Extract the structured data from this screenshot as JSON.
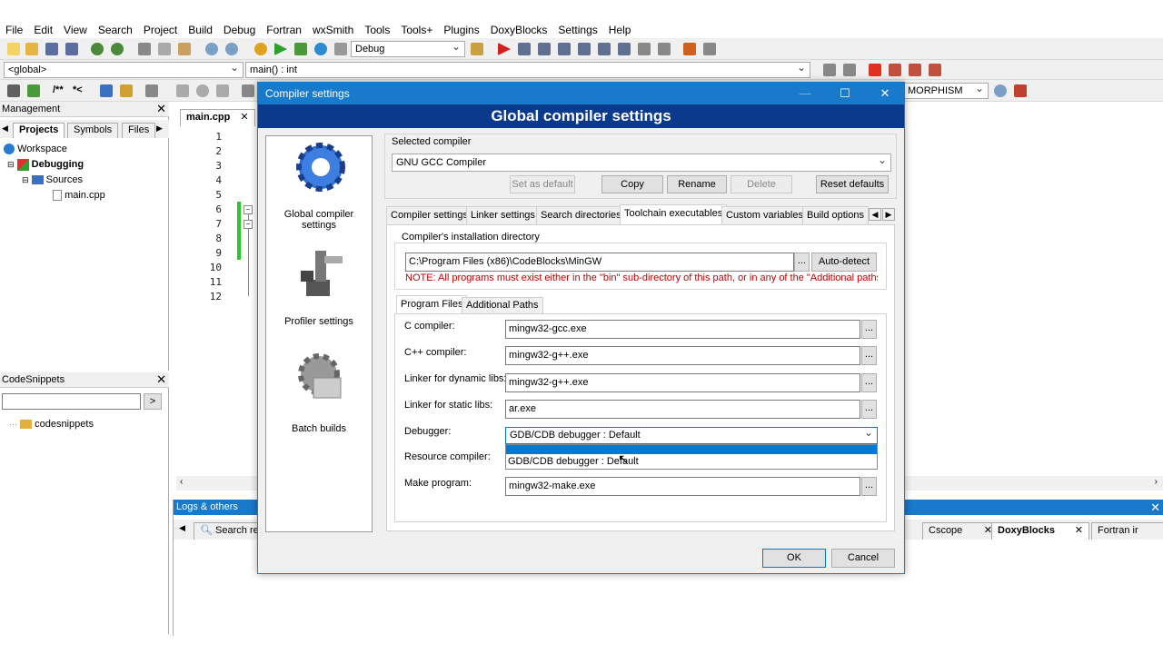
{
  "menu": [
    "File",
    "Edit",
    "View",
    "Search",
    "Project",
    "Build",
    "Debug",
    "Fortran",
    "wxSmith",
    "Tools",
    "Tools+",
    "Plugins",
    "DoxyBlocks",
    "Settings",
    "Help"
  ],
  "toolbar": {
    "build_target": "Debug",
    "scope": "<global>",
    "function": "main() : int",
    "search_combo": "MORPHISM"
  },
  "management": {
    "title": "Management",
    "tabs": [
      "Projects",
      "Symbols",
      "Files"
    ],
    "tree": {
      "workspace": "Workspace",
      "project": "Debugging",
      "folder": "Sources",
      "file": "main.cpp"
    }
  },
  "codesnippets": {
    "title": "CodeSnippets",
    "search_btn": ">",
    "item": "codesnippets"
  },
  "editor": {
    "tab": "main.cpp",
    "lines": [
      "1",
      "2",
      "3",
      "4",
      "5",
      "6",
      "7",
      "8",
      "9",
      "10",
      "11",
      "12"
    ]
  },
  "logs": {
    "title": "Logs & others",
    "tab1": "Search res",
    "tabs_right": [
      "Cscope",
      "DoxyBlocks",
      "Fortran ir"
    ]
  },
  "dialog": {
    "title": "Compiler settings",
    "header": "Global compiler settings",
    "left_items": [
      "Global compiler settings",
      "Profiler settings",
      "Batch builds"
    ],
    "selected_compiler_label": "Selected compiler",
    "selected_compiler": "GNU GCC Compiler",
    "buttons": {
      "set_default": "Set as default",
      "copy": "Copy",
      "rename": "Rename",
      "delete": "Delete",
      "reset": "Reset defaults",
      "ok": "OK",
      "cancel": "Cancel"
    },
    "tabs": [
      "Compiler settings",
      "Linker settings",
      "Search directories",
      "Toolchain executables",
      "Custom variables",
      "Build options"
    ],
    "install_dir_label": "Compiler's installation directory",
    "install_dir": "C:\\Program Files (x86)\\CodeBlocks\\MinGW",
    "autodetect": "Auto-detect",
    "note": "NOTE: All programs must exist either in the \"bin\" sub-directory of this path, or in any of the \"Additional paths\"...",
    "subtabs": [
      "Program Files",
      "Additional Paths"
    ],
    "programs": [
      {
        "label": "C compiler:",
        "value": "mingw32-gcc.exe"
      },
      {
        "label": "C++ compiler:",
        "value": "mingw32-g++.exe"
      },
      {
        "label": "Linker for dynamic libs:",
        "value": "mingw32-g++.exe"
      },
      {
        "label": "Linker for static libs:",
        "value": "ar.exe"
      }
    ],
    "debugger_label": "Debugger:",
    "debugger_value": "GDB/CDB debugger : Default",
    "debugger_option": "GDB/CDB debugger : Default",
    "resource_label": "Resource compiler:",
    "make_label": "Make program:",
    "make_value": "mingw32-make.exe",
    "dots": "..."
  }
}
